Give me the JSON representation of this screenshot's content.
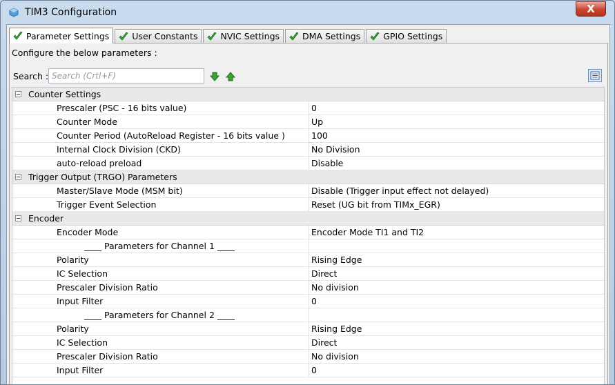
{
  "window": {
    "title": "TIM3 Configuration",
    "close_label": "X"
  },
  "tabs": [
    {
      "label": "Parameter Settings",
      "active": true
    },
    {
      "label": "User Constants",
      "active": false
    },
    {
      "label": "NVIC Settings",
      "active": false
    },
    {
      "label": "DMA Settings",
      "active": false
    },
    {
      "label": "GPIO Settings",
      "active": false
    }
  ],
  "intro": "Configure the below parameters :",
  "search": {
    "label": "Search :",
    "placeholder": "Search (Crtl+F)",
    "value": ""
  },
  "groups": [
    {
      "label": "Counter Settings",
      "rows": [
        {
          "name": "Prescaler (PSC - 16 bits value)",
          "value": "0"
        },
        {
          "name": "Counter Mode",
          "value": "Up"
        },
        {
          "name": "Counter Period (AutoReload Register - 16 bits value )",
          "value": "100"
        },
        {
          "name": "Internal Clock Division (CKD)",
          "value": "No Division"
        },
        {
          "name": "auto-reload preload",
          "value": "Disable"
        }
      ]
    },
    {
      "label": "Trigger Output (TRGO) Parameters",
      "rows": [
        {
          "name": "Master/Slave Mode (MSM bit)",
          "value": "Disable (Trigger input effect not delayed)"
        },
        {
          "name": "Trigger Event Selection",
          "value": "Reset (UG bit from TIMx_EGR)"
        }
      ]
    },
    {
      "label": "Encoder",
      "rows": [
        {
          "name": "Encoder Mode",
          "value": "Encoder Mode TI1 and TI2"
        },
        {
          "name": "____ Parameters for Channel 1 ____",
          "value": "",
          "sub": true
        },
        {
          "name": "Polarity",
          "value": "Rising Edge"
        },
        {
          "name": "IC Selection",
          "value": "Direct"
        },
        {
          "name": "Prescaler Division Ratio",
          "value": "No division"
        },
        {
          "name": "Input Filter",
          "value": "0"
        },
        {
          "name": "____ Parameters for Channel 2 ____",
          "value": "",
          "sub": true
        },
        {
          "name": "Polarity",
          "value": "Rising Edge"
        },
        {
          "name": "IC Selection",
          "value": "Direct"
        },
        {
          "name": "Prescaler Division Ratio",
          "value": "No division"
        },
        {
          "name": "Input Filter",
          "value": "0"
        }
      ]
    }
  ],
  "icons": {
    "app": "cube-icon",
    "tab_status": "green-check-icon",
    "search_next": "green-arrow-down-icon",
    "search_prev": "green-arrow-up-icon",
    "view_toggle": "list-view-icon"
  },
  "colors": {
    "accent_green": "#3aa335",
    "close_red": "#c9452f",
    "group_bg": "#e9e9e9"
  }
}
